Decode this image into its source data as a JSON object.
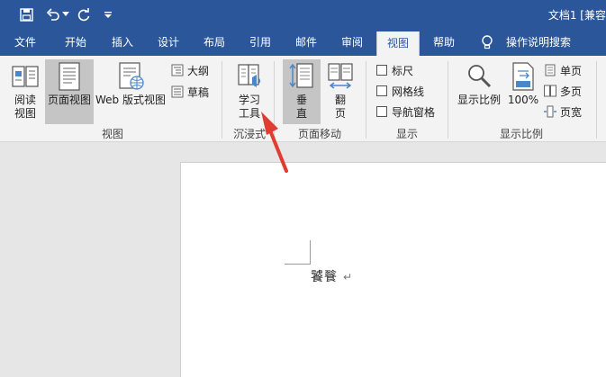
{
  "window": {
    "doc_title": "文档1 [兼容"
  },
  "quick_access": {
    "save_icon": "save-icon",
    "undo_icon": "undo-icon",
    "undo_dropdown_icon": "chevron-down-icon",
    "redo_icon": "redo-icon",
    "customize_icon": "customize-icon"
  },
  "tabs": [
    {
      "label": "文件"
    },
    {
      "label": "开始"
    },
    {
      "label": "插入"
    },
    {
      "label": "设计"
    },
    {
      "label": "布局"
    },
    {
      "label": "引用"
    },
    {
      "label": "邮件"
    },
    {
      "label": "审阅"
    },
    {
      "label": "视图"
    },
    {
      "label": "帮助"
    }
  ],
  "tell_me": {
    "label": "操作说明搜索",
    "icon": "lightbulb-icon"
  },
  "ribbon": {
    "views": {
      "read_mode": "阅读\n视图",
      "print_layout": "页面视图",
      "web_layout": "Web 版式视图",
      "outline": "大纲",
      "draft": "草稿",
      "group_label": "视图"
    },
    "immersive": {
      "learning_tools": "学习\n工具",
      "group_label": "沉浸式"
    },
    "page_movement": {
      "vertical": "垂\n直",
      "side_to_side": "翻\n页",
      "group_label": "页面移动"
    },
    "show": {
      "ruler": "标尺",
      "gridlines": "网格线",
      "navigation_pane": "导航窗格",
      "group_label": "显示"
    },
    "zoom": {
      "zoom": "显示比例",
      "hundred_percent": "100%",
      "one_page": "单页",
      "multiple_pages": "多页",
      "page_width": "页宽",
      "group_label": "显示比例"
    }
  },
  "document": {
    "text": "饕餮"
  },
  "colors": {
    "brand": "#2b579a",
    "ribbon_bg": "#f3f3f3",
    "arrow": "#e03c31"
  }
}
